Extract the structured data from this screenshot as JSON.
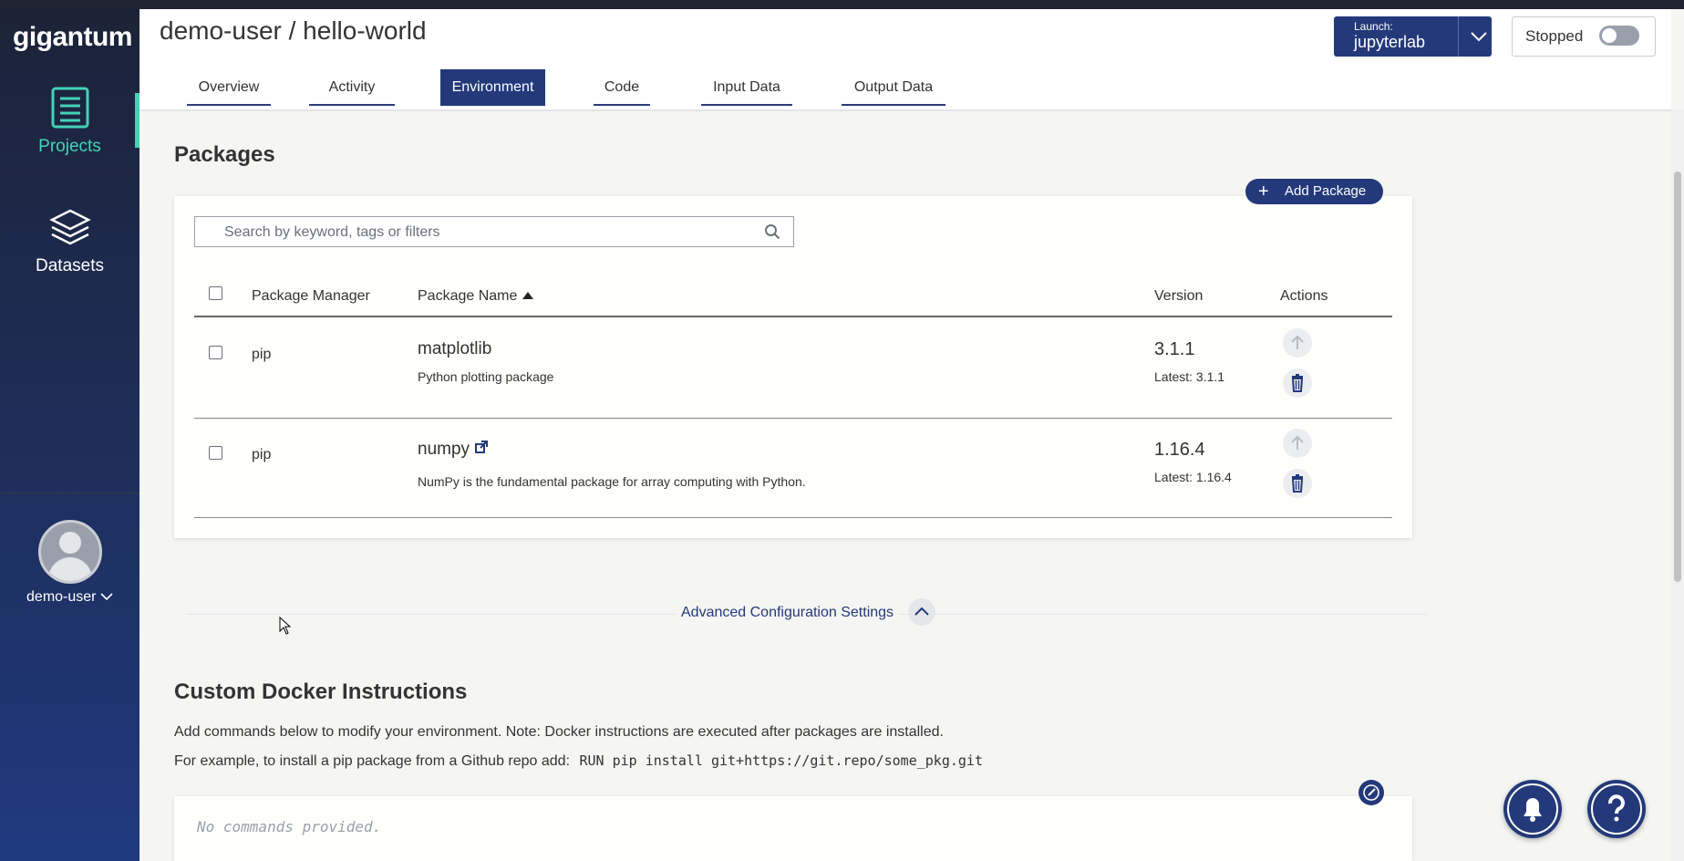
{
  "app": {
    "logo": "gigantum"
  },
  "sidebar": {
    "items": [
      {
        "label": "Projects",
        "icon": "projects-icon"
      },
      {
        "label": "Datasets",
        "icon": "datasets-icon"
      }
    ],
    "user": {
      "name": "demo-user"
    }
  },
  "header": {
    "title": "demo-user / hello-world",
    "tabs": [
      "Overview",
      "Activity",
      "Environment",
      "Code",
      "Input Data",
      "Output Data"
    ],
    "active_tab": "Environment",
    "launch": {
      "label": "Launch:",
      "value": "jupyterlab"
    },
    "status": {
      "label": "Stopped",
      "running": false
    }
  },
  "packages": {
    "title": "Packages",
    "add_label": "Add Package",
    "search_placeholder": "Search by keyword, tags or filters",
    "columns": {
      "manager": "Package Manager",
      "name": "Package Name",
      "version": "Version",
      "actions": "Actions"
    },
    "rows": [
      {
        "manager": "pip",
        "name": "matplotlib",
        "description": "Python plotting package",
        "version": "3.1.1",
        "latest": "Latest: 3.1.1"
      },
      {
        "manager": "pip",
        "name": "numpy",
        "description": "NumPy is the fundamental package for array computing with Python.",
        "version": "1.16.4",
        "latest": "Latest: 1.16.4"
      }
    ]
  },
  "advanced": {
    "label": "Advanced Configuration Settings"
  },
  "docker": {
    "title": "Custom Docker Instructions",
    "description": "Add commands below to modify your environment. Note: Docker instructions are executed after packages are installed.",
    "example_label": "For example, to install a pip package from a Github repo add:",
    "example_code": "RUN pip install git+https://git.repo/some_pkg.git",
    "placeholder": "No commands provided."
  },
  "colors": {
    "primary": "#23397a",
    "accent": "#43d3b6",
    "background": "#f5f6f3"
  }
}
